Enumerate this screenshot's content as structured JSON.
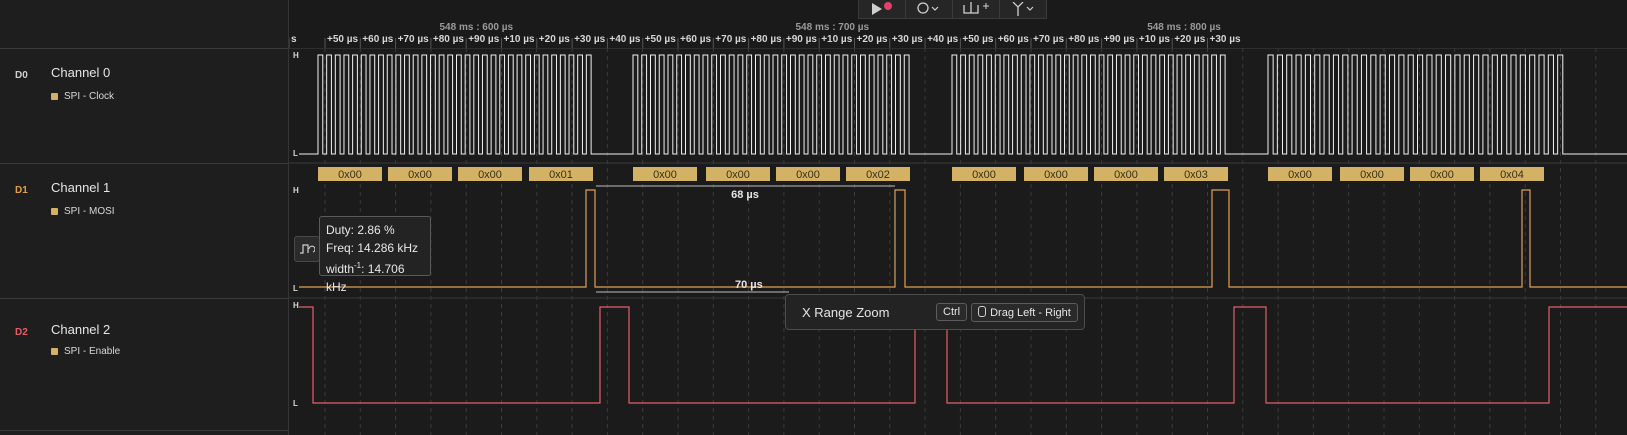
{
  "colors": {
    "clock": "#f2f2f2",
    "mosi": "#e0a050",
    "enable": "#e0606a",
    "byte_box": "#d4b265",
    "grid": "#3a3a3a"
  },
  "channels": [
    {
      "id": "D0",
      "name": "Channel 0",
      "analyzer": "SPI - Clock",
      "id_color": "#cfcfcf"
    },
    {
      "id": "D1",
      "name": "Channel 1",
      "analyzer": "SPI - MOSI",
      "id_color": "#e0a050"
    },
    {
      "id": "D2",
      "name": "Channel 2",
      "analyzer": "SPI - Enable",
      "id_color": "#e0606a"
    }
  ],
  "level_labels": {
    "high": "H",
    "low": "L"
  },
  "ruler": {
    "major": [
      "548 ms : 600 µs",
      "548 ms : 700 µs",
      "548 ms : 800 µs"
    ],
    "ticks": [
      "s",
      "+50 µs",
      "+60 µs",
      "+70 µs",
      "+80 µs",
      "+90 µs",
      "+10 µs",
      "+20 µs",
      "+30 µs",
      "+40 µs",
      "+50 µs",
      "+60 µs",
      "+70 µs",
      "+80 µs",
      "+90 µs",
      "+10 µs",
      "+20 µs",
      "+30 µs",
      "+40 µs",
      "+50 µs",
      "+60 µs",
      "+70 µs",
      "+80 µs",
      "+90 µs",
      "+10 µs",
      "+20 µs",
      "+30 µs"
    ]
  },
  "decoded_bytes": [
    "0x00",
    "0x00",
    "0x00",
    "0x01",
    "0x00",
    "0x00",
    "0x00",
    "0x02",
    "0x00",
    "0x00",
    "0x00",
    "0x03",
    "0x00",
    "0x00",
    "0x00",
    "0x04"
  ],
  "measurements": {
    "upper": "68 µs",
    "lower": "70 µs"
  },
  "duty_tooltip": {
    "duty": "Duty: 2.86 %",
    "freq": "Freq: 14.286 kHz",
    "width_prefix": "width",
    "width_sup": "-1",
    "width_value": ": 14.706 kHz"
  },
  "zoom_hint": {
    "title": "X Range Zoom",
    "key": "Ctrl",
    "action": "Drag Left - Right"
  },
  "toolbar": {
    "icons": [
      "play-record-icon",
      "protocol-icon",
      "add-marker-icon",
      "trigger-icon"
    ]
  }
}
